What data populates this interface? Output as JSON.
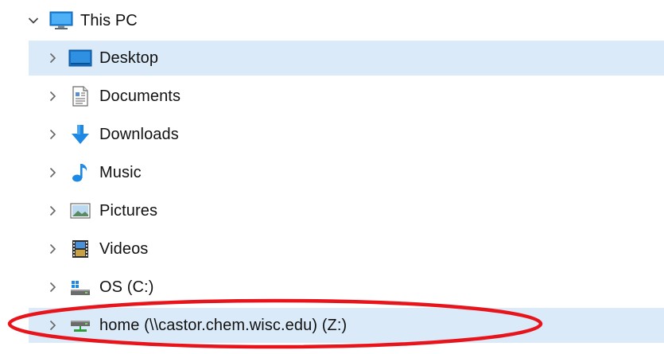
{
  "tree": {
    "root": {
      "label": "This PC",
      "expanded": true
    },
    "items": [
      {
        "label": "Desktop",
        "icon": "desktop-icon",
        "selected": true
      },
      {
        "label": "Documents",
        "icon": "documents-icon",
        "selected": false
      },
      {
        "label": "Downloads",
        "icon": "downloads-icon",
        "selected": false
      },
      {
        "label": "Music",
        "icon": "music-icon",
        "selected": false
      },
      {
        "label": "Pictures",
        "icon": "pictures-icon",
        "selected": false
      },
      {
        "label": "Videos",
        "icon": "videos-icon",
        "selected": false
      },
      {
        "label": "OS (C:)",
        "icon": "local-drive-icon",
        "selected": false
      },
      {
        "label": "home (\\\\castor.chem.wisc.edu) (Z:)",
        "icon": "network-drive-icon",
        "selected": true
      }
    ]
  },
  "colors": {
    "selection": "#dbeaf8",
    "annotation_ring": "#e8141b",
    "accent_blue": "#1e88e5"
  }
}
